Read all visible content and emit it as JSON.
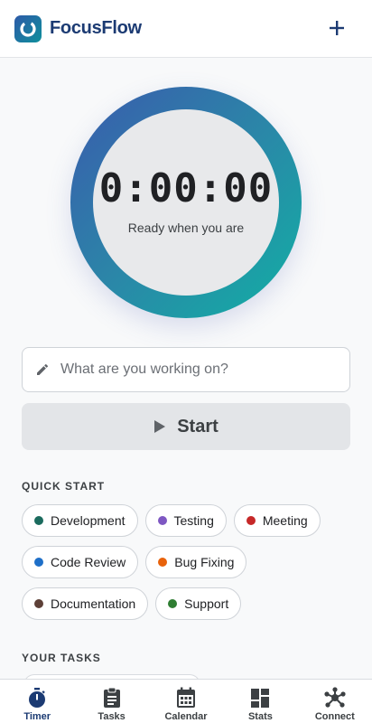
{
  "app": {
    "name": "FocusFlow",
    "add_icon": "plus-icon",
    "logo_icon": "focusflow-logo"
  },
  "timer": {
    "time": "0:00:00",
    "status": "Ready when you are"
  },
  "task_input": {
    "placeholder": "What are you working on?",
    "value": "",
    "icon": "pencil-icon"
  },
  "start_button": {
    "label": "Start",
    "icon": "play-icon"
  },
  "quick_start": {
    "title": "QUICK START",
    "items": [
      {
        "label": "Development",
        "color": "#1b6b5e"
      },
      {
        "label": "Testing",
        "color": "#7e57c2"
      },
      {
        "label": "Meeting",
        "color": "#c62828"
      },
      {
        "label": "Code Review",
        "color": "#1e6fc8"
      },
      {
        "label": "Bug Fixing",
        "color": "#e8620b"
      },
      {
        "label": "Documentation",
        "color": "#5d4037"
      },
      {
        "label": "Support",
        "color": "#2e7d32"
      }
    ]
  },
  "your_tasks": {
    "title": "YOUR TASKS"
  },
  "nav": {
    "items": [
      {
        "label": "Timer",
        "icon": "stopwatch-icon",
        "active": true
      },
      {
        "label": "Tasks",
        "icon": "clipboard-icon",
        "active": false
      },
      {
        "label": "Calendar",
        "icon": "calendar-icon",
        "active": false
      },
      {
        "label": "Stats",
        "icon": "dashboard-icon",
        "active": false
      },
      {
        "label": "Connect",
        "icon": "hub-icon",
        "active": false
      }
    ]
  },
  "colors": {
    "brand": "#1c3b73",
    "ring_start": "#3a5aad",
    "ring_end": "#11b0a4",
    "background": "#f8f9fa"
  }
}
